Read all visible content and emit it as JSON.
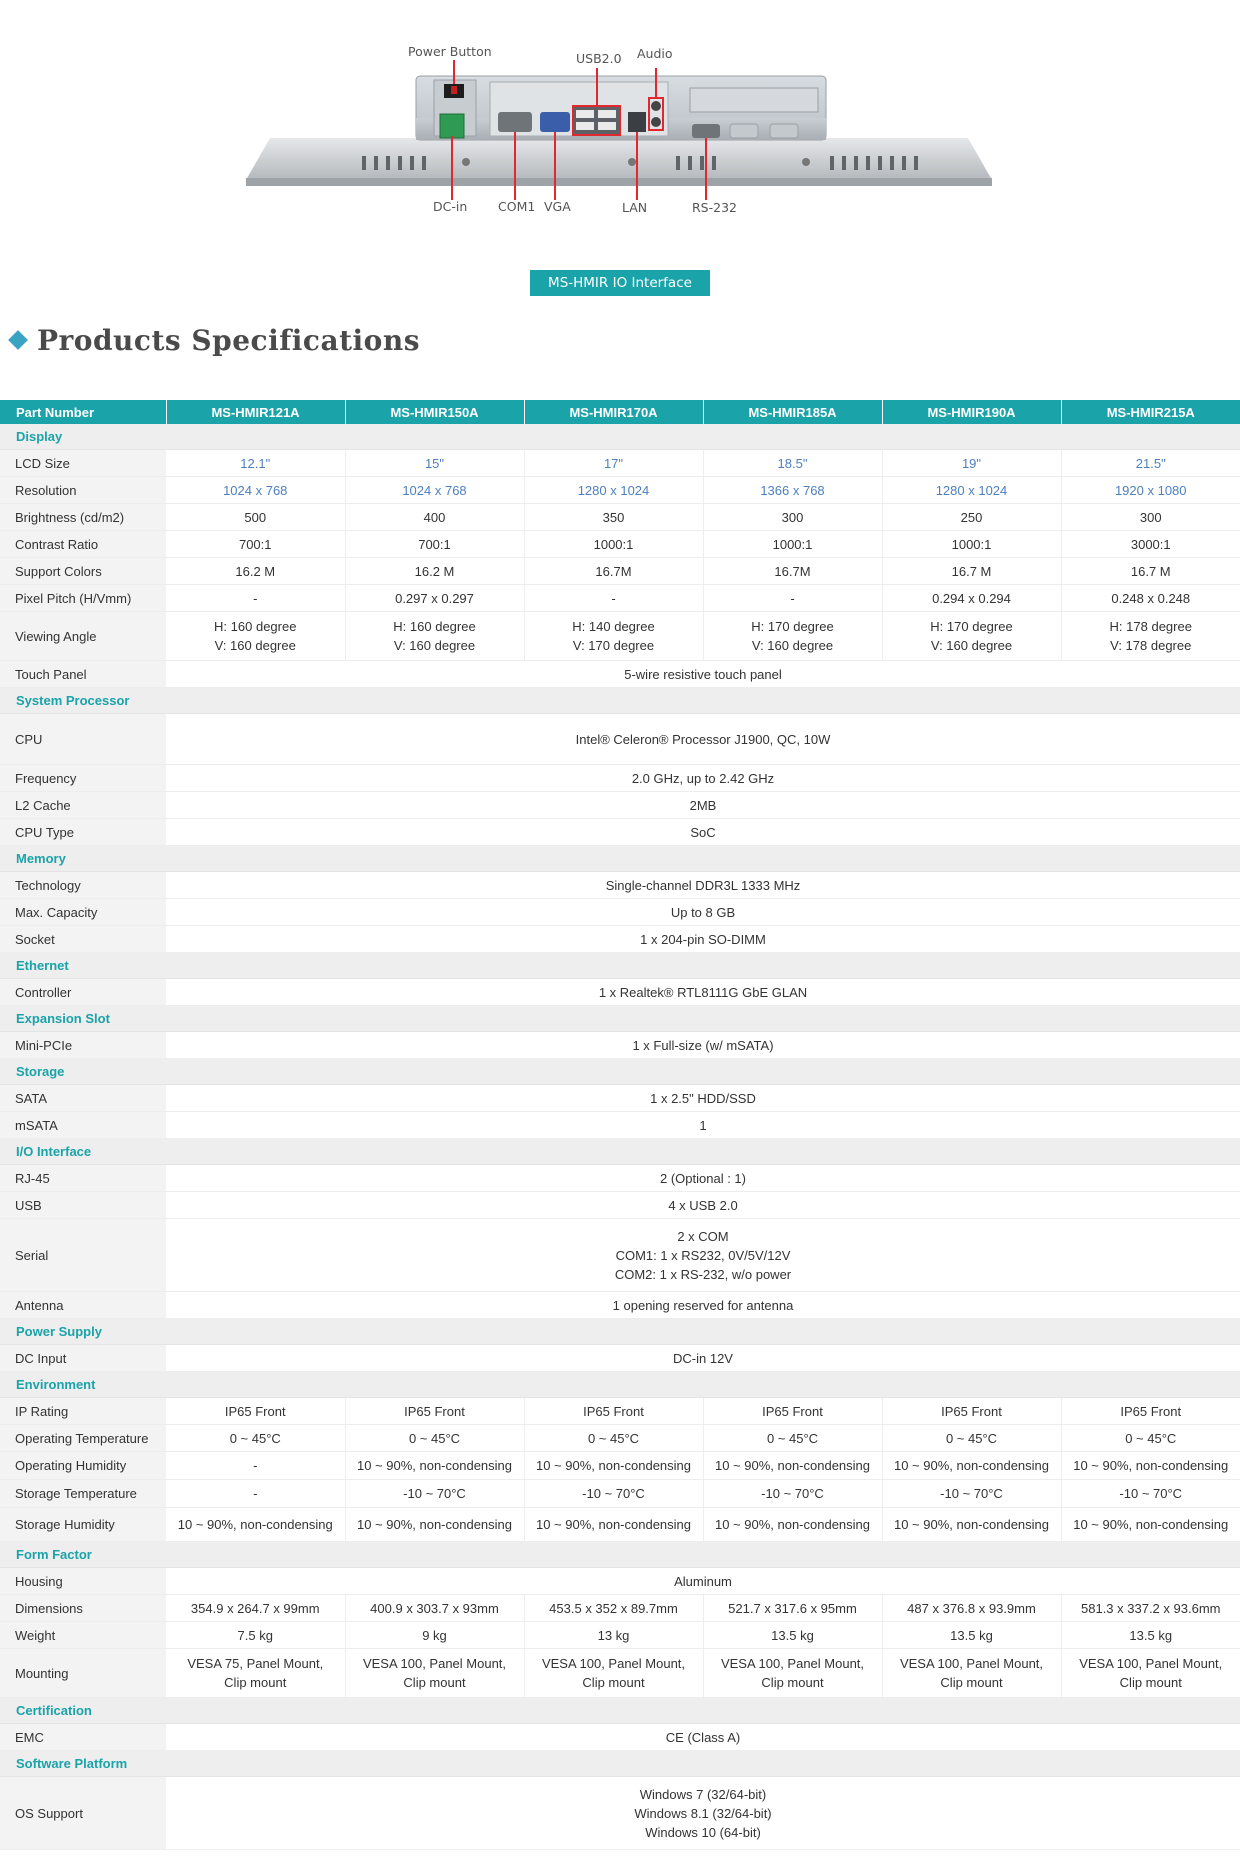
{
  "io": {
    "labels": {
      "power_button": "Power Button",
      "usb": "USB2.0",
      "audio": "Audio",
      "dc_in": "DC-in",
      "com1": "COM1",
      "vga": "VGA",
      "lan": "LAN",
      "rs232": "RS-232"
    },
    "caption": "MS-HMIR  IO Interface",
    "colors": {
      "callout_line": "#e0282e",
      "caption_bg": "#1aa3a9"
    }
  },
  "heading": {
    "title": "Products Specifications"
  },
  "colors": {
    "header_bg": "#1aa3a9",
    "section_text": "#1aa3a9",
    "blue_value": "#4d7fbf",
    "diamond": "#3aa3c3"
  },
  "table": {
    "header_label": "Part Number",
    "models": [
      "MS-HMIR121A",
      "MS-HMIR150A",
      "MS-HMIR170A",
      "MS-HMIR185A",
      "MS-HMIR190A",
      "MS-HMIR215A"
    ],
    "sections": [
      {
        "title": "Display",
        "rows": [
          {
            "label": "LCD Size",
            "values": [
              "12.1\"",
              "15\"",
              "17\"",
              "18.5\"",
              "19\"",
              "21.5\""
            ],
            "blue": true
          },
          {
            "label": "Resolution",
            "values": [
              "1024 x 768",
              "1024 x 768",
              "1280 x 1024",
              "1366 x 768",
              "1280 x 1024",
              "1920 x 1080"
            ],
            "blue": true
          },
          {
            "label": "Brightness (cd/m2)",
            "values": [
              "500",
              "400",
              "350",
              "300",
              "250",
              "300"
            ]
          },
          {
            "label": "Contrast Ratio",
            "values": [
              "700:1",
              "700:1",
              "1000:1",
              "1000:1",
              "1000:1",
              "3000:1"
            ]
          },
          {
            "label": "Support Colors",
            "values": [
              "16.2 M",
              "16.2 M",
              "16.7M",
              "16.7M",
              "16.7 M",
              "16.7 M"
            ]
          },
          {
            "label": "Pixel Pitch (H/Vmm)",
            "values": [
              "-",
              "0.297 x 0.297",
              "-",
              "-",
              "0.294 x 0.294",
              "0.248 x 0.248"
            ]
          },
          {
            "label": "Viewing Angle",
            "lines": 2,
            "values": [
              [
                "H: 160 degree",
                "V: 160 degree"
              ],
              [
                "H: 160 degree",
                "V: 160 degree"
              ],
              [
                "H: 140 degree",
                "V: 170 degree"
              ],
              [
                "H: 170 degree",
                "V: 160 degree"
              ],
              [
                "H: 170 degree",
                "V: 160 degree"
              ],
              [
                "H: 178 degree",
                "V: 178 degree"
              ]
            ]
          },
          {
            "label": "Touch Panel",
            "span": [
              "5-wire resistive touch panel"
            ]
          }
        ]
      },
      {
        "title": "System Processor",
        "rows": [
          {
            "label": "CPU",
            "span": [
              "Intel® Celeron® Processor J1900, QC, 10W"
            ],
            "cls": "rcpu"
          },
          {
            "label": "Frequency",
            "span": [
              "2.0 GHz, up to 2.42 GHz"
            ]
          },
          {
            "label": "L2 Cache",
            "span": [
              "2MB"
            ]
          },
          {
            "label": "CPU Type",
            "span": [
              "SoC"
            ]
          }
        ]
      },
      {
        "title": "Memory",
        "rows": [
          {
            "label": "Technology",
            "span": [
              "Single-channel DDR3L 1333 MHz"
            ]
          },
          {
            "label": "Max. Capacity",
            "span": [
              "Up to 8 GB"
            ]
          },
          {
            "label": "Socket",
            "span": [
              "1 x 204-pin SO-DIMM"
            ]
          }
        ]
      },
      {
        "title": "Ethernet",
        "rows": [
          {
            "label": "Controller",
            "span": [
              "1 x Realtek® RTL8111G GbE GLAN"
            ]
          }
        ]
      },
      {
        "title": "Expansion Slot",
        "rows": [
          {
            "label": "Mini-PCIe",
            "span": [
              "1 x Full-size (w/ mSATA)"
            ]
          }
        ]
      },
      {
        "title": "Storage",
        "rows": [
          {
            "label": "SATA",
            "span": [
              "1 x 2.5\" HDD/SSD"
            ]
          },
          {
            "label": "mSATA",
            "span": [
              "1"
            ]
          }
        ]
      },
      {
        "title": "I/O Interface",
        "rows": [
          {
            "label": "RJ-45",
            "span": [
              "2 (Optional : 1)"
            ]
          },
          {
            "label": "USB",
            "span": [
              "4 x USB 2.0"
            ]
          },
          {
            "label": "Serial",
            "span": [
              "2 x COM",
              "COM1: 1 x RS232, 0V/5V/12V",
              "COM2: 1 x RS-232, w/o power"
            ],
            "cls": "r3"
          },
          {
            "label": "Antenna",
            "span": [
              "1 opening reserved for antenna"
            ]
          }
        ]
      },
      {
        "title": "Power Supply",
        "rows": [
          {
            "label": "DC Input",
            "span": [
              "DC-in 12V"
            ]
          }
        ]
      },
      {
        "title": "Environment",
        "rows": [
          {
            "label": "IP Rating",
            "values": [
              "IP65 Front",
              "IP65 Front",
              "IP65 Front",
              "IP65 Front",
              "IP65 Front",
              "IP65 Front"
            ]
          },
          {
            "label": "Operating Temperature",
            "values": [
              "0 ~ 45°C",
              "0 ~ 45°C",
              "0 ~ 45°C",
              "0 ~ 45°C",
              "0 ~ 45°C",
              "0 ~ 45°C"
            ]
          },
          {
            "label": "Operating Humidity",
            "values": [
              "-",
              "10 ~ 90%, non-condensing",
              "10 ~ 90%, non-condensing",
              "10 ~ 90%, non-condensing",
              "10 ~ 90%, non-condensing",
              "10 ~ 90%, non-condensing"
            ],
            "cls": "rtall"
          },
          {
            "label": "Storage Temperature",
            "values": [
              "-",
              "-10 ~ 70°C",
              "-10 ~ 70°C",
              "-10 ~ 70°C",
              "-10 ~ 70°C",
              "-10 ~ 70°C"
            ],
            "cls": "rtall"
          },
          {
            "label": "Storage Humidity",
            "values": [
              "10 ~ 90%, non-condensing",
              "10 ~ 90%, non-condensing",
              "10 ~ 90%, non-condensing",
              "10 ~ 90%, non-condensing",
              "10 ~ 90%, non-condensing",
              "10 ~ 90%, non-condensing"
            ],
            "cls": "rtall2"
          }
        ]
      },
      {
        "title": "Form Factor",
        "rows": [
          {
            "label": "Housing",
            "span": [
              "Aluminum"
            ]
          },
          {
            "label": "Dimensions",
            "values": [
              "354.9 x 264.7 x 99mm",
              "400.9 x 303.7 x 93mm",
              "453.5 x 352 x 89.7mm",
              "521.7 x 317.6 x 95mm",
              "487 x 376.8 x 93.9mm",
              "581.3 x 337.2 x 93.6mm"
            ]
          },
          {
            "label": "Weight",
            "values": [
              "7.5 kg",
              "9 kg",
              "13 kg",
              "13.5 kg",
              "13.5 kg",
              "13.5 kg"
            ]
          },
          {
            "label": "Mounting",
            "lines": 2,
            "values": [
              [
                "VESA 75, Panel Mount,",
                "Clip mount"
              ],
              [
                "VESA 100, Panel Mount,",
                "Clip mount"
              ],
              [
                "VESA 100, Panel Mount,",
                "Clip mount"
              ],
              [
                "VESA 100, Panel Mount,",
                "Clip mount"
              ],
              [
                "VESA 100, Panel Mount,",
                "Clip mount"
              ],
              [
                "VESA 100, Panel Mount,",
                "Clip mount"
              ]
            ]
          }
        ]
      },
      {
        "title": "Certification",
        "rows": [
          {
            "label": "EMC",
            "span": [
              "CE (Class A)"
            ]
          }
        ]
      },
      {
        "title": "Software Platform",
        "rows": [
          {
            "label": "OS Support",
            "span": [
              "Windows 7 (32/64-bit)",
              "Windows 8.1 (32/64-bit)",
              "Windows 10 (64-bit)"
            ],
            "cls": "r3"
          }
        ]
      }
    ]
  }
}
